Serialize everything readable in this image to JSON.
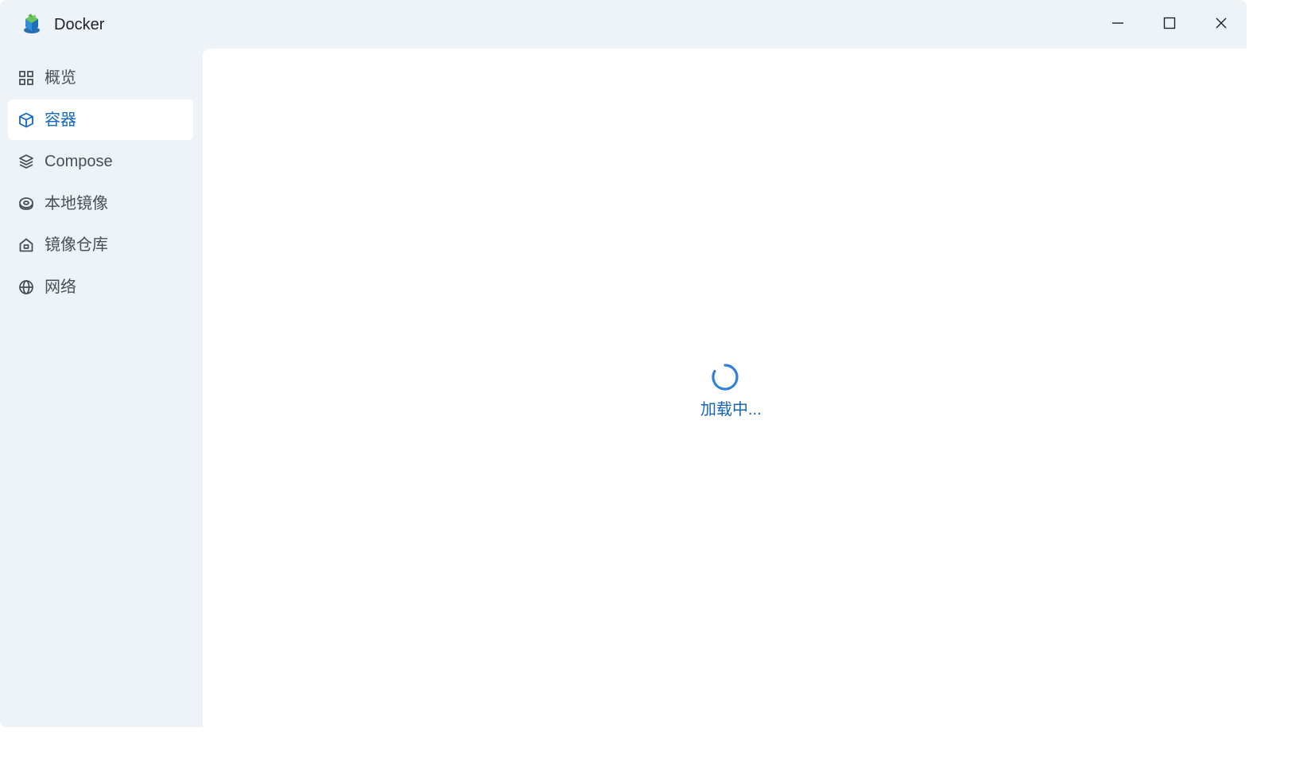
{
  "app": {
    "title": "Docker",
    "icon": "docker-app-icon"
  },
  "window_controls": {
    "minimize": "minimize-icon",
    "maximize": "maximize-icon",
    "close": "close-icon"
  },
  "sidebar": {
    "items": [
      {
        "label": "概览",
        "icon": "grid-icon",
        "active": false
      },
      {
        "label": "容器",
        "icon": "cube-icon",
        "active": true
      },
      {
        "label": "Compose",
        "icon": "layers-icon",
        "active": false
      },
      {
        "label": "本地镜像",
        "icon": "disk-icon",
        "active": false
      },
      {
        "label": "镜像仓库",
        "icon": "home-icon",
        "active": false
      },
      {
        "label": "网络",
        "icon": "globe-icon",
        "active": false
      }
    ]
  },
  "main": {
    "loading_text": "加载中..."
  },
  "colors": {
    "accent": "#1269c4",
    "sidebar_bg": "#eef3f8",
    "content_bg": "#ffffff",
    "spinner": "#2f7fd6"
  }
}
